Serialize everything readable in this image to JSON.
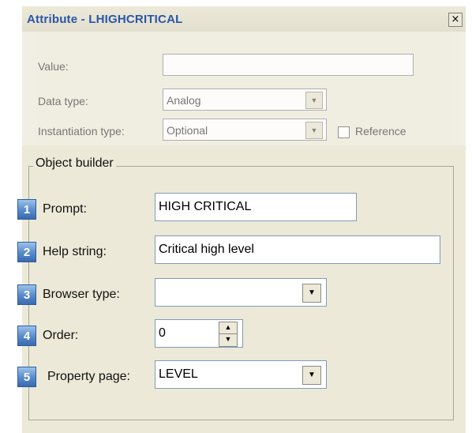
{
  "window": {
    "title": "Attribute - LHIGHCRITICAL",
    "close_label": "×"
  },
  "upper_form": {
    "value_label": "Value:",
    "value_field": "",
    "data_type_label": "Data type:",
    "data_type_value": "Analog",
    "instantiation_label": "Instantiation type:",
    "instantiation_value": "Optional",
    "reference_label": "Reference",
    "reference_checked": false
  },
  "object_builder": {
    "title": "Object builder",
    "rows": [
      {
        "number": "1",
        "label": "Prompt:",
        "value": "HIGH CRITICAL"
      },
      {
        "number": "2",
        "label": "Help string:",
        "value": "Critical high level"
      },
      {
        "number": "3",
        "label": "Browser type:",
        "value": ""
      },
      {
        "number": "4",
        "label": "Order:",
        "value": "0"
      },
      {
        "number": "5",
        "label": "Property page:",
        "value": "LEVEL"
      }
    ]
  },
  "icons": {
    "dropdown": "▼",
    "spin_up": "▲",
    "spin_down": "▼"
  },
  "colors": {
    "title": "#2b55a8",
    "badge": "#5889c8",
    "dialog_bg": "#ECE9D8"
  }
}
